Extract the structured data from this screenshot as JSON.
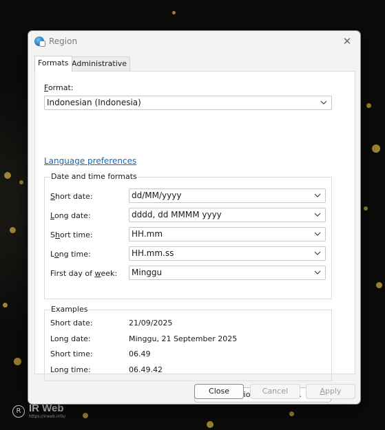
{
  "window": {
    "title": "Region",
    "close_glyph": "✕"
  },
  "tabs": [
    {
      "label": "Formats",
      "active": true
    },
    {
      "label": "Administrative",
      "active": false
    }
  ],
  "format": {
    "label_accesskey": "F",
    "label_rest": "ormat:",
    "value": "Indonesian (Indonesia)"
  },
  "language_link": "Language preferences",
  "date_time": {
    "title": "Date and time formats",
    "rows": [
      {
        "label_accesskey": "S",
        "label_rest": "hort date:",
        "value": "dd/MM/yyyy"
      },
      {
        "label_accesskey": "L",
        "label_rest": "ong date:",
        "value": "dddd, dd MMMM yyyy"
      },
      {
        "label_pre": "S",
        "label_accesskey": "h",
        "label_rest": "ort time:",
        "value": "HH.mm"
      },
      {
        "label_pre": "L",
        "label_accesskey": "o",
        "label_rest": "ng time:",
        "value": "HH.mm.ss"
      },
      {
        "label_pre": "First day of ",
        "label_accesskey": "w",
        "label_rest": "eek:",
        "value": "Minggu"
      }
    ]
  },
  "examples": {
    "title": "Examples",
    "rows": [
      {
        "label": "Short date:",
        "value": "21/09/2025"
      },
      {
        "label": "Long date:",
        "value": "Minggu, 21 September 2025"
      },
      {
        "label": "Short time:",
        "value": "06.49"
      },
      {
        "label": "Long time:",
        "value": "06.49.42"
      }
    ]
  },
  "additional_settings": {
    "pre": "A",
    "accesskey": "d",
    "rest": "ditional settings..."
  },
  "buttons": {
    "close": "Close",
    "cancel": "Cancel",
    "apply_accesskey": "A",
    "apply_rest": "pply"
  },
  "watermark": {
    "logo": "R",
    "name": "IR Web",
    "url": "https://irweb.info/"
  },
  "colors": {
    "link": "#1a66b0",
    "wallpaper_gold": "#b79a3c"
  },
  "icons": {
    "title": "globe-region-icon",
    "dropdown": "chevron-down-icon"
  }
}
